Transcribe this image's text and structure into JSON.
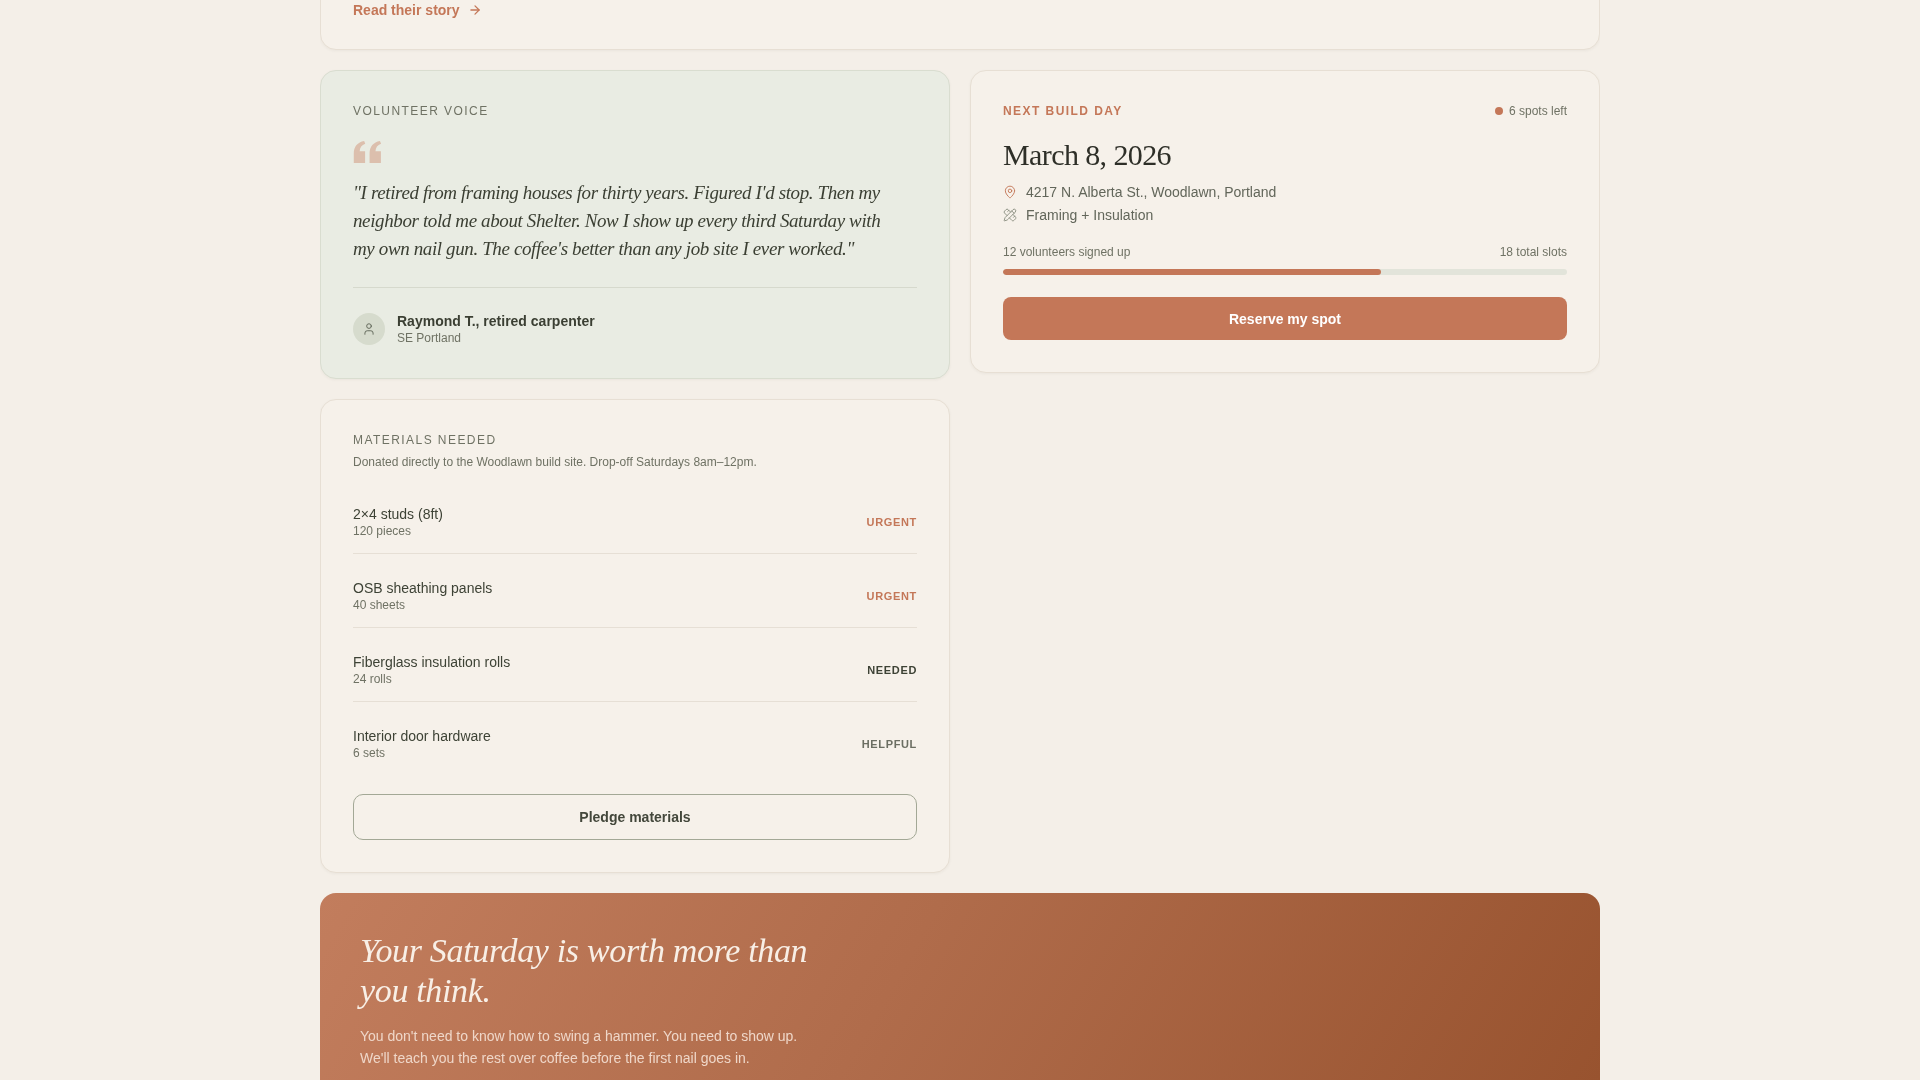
{
  "story_card": {
    "link": "Read their story"
  },
  "volunteer_voice": {
    "label": "VOLUNTEER VOICE",
    "quote": "\"I retired from framing houses for thirty years. Figured I'd stop. Then my neighbor told me about Shelter. Now I show up every third Saturday with my own nail gun. The coffee's better than any job site I ever worked.\"",
    "author": {
      "name": "Raymond T., retired carpenter",
      "location": "SE Portland"
    }
  },
  "next_build_day": {
    "label": "NEXT BUILD DAY",
    "availability": "6 spots left",
    "date": "March 8, 2026",
    "details": [
      {
        "kind": "location",
        "text": "4217 N. Alberta St., Woodlawn, Portland"
      },
      {
        "kind": "task",
        "text": "Framing + Insulation"
      }
    ],
    "signup": {
      "signed_up": "12 volunteers signed up",
      "total": "18 total slots",
      "level": 0.67
    },
    "button": "Reserve my spot"
  },
  "materials": {
    "label": "MATERIALS NEEDED",
    "note": "Donated directly to the Woodlawn build site. Drop-off Saturdays 8am–12pm.",
    "items": [
      {
        "name": "2×4 studs (8ft)",
        "quantity": "120 pieces",
        "priority": "URGENT",
        "color": "#c47758"
      },
      {
        "name": "OSB sheathing panels",
        "quantity": "40 sheets",
        "priority": "URGENT",
        "color": "#c47758"
      },
      {
        "name": "Fiberglass insulation rolls",
        "quantity": "24 rolls",
        "priority": "NEEDED",
        "color": "#3d4235"
      },
      {
        "name": "Interior door hardware",
        "quantity": "6 sets",
        "priority": "HELPFUL",
        "color": "#6b6e62"
      }
    ],
    "button": "Pledge materials"
  },
  "cta": {
    "title": "Your Saturday is worth more than you think.",
    "body": "You don't need to know how to swing a hammer. You need to show up. We'll teach you the rest over coffee before the first nail goes in."
  }
}
